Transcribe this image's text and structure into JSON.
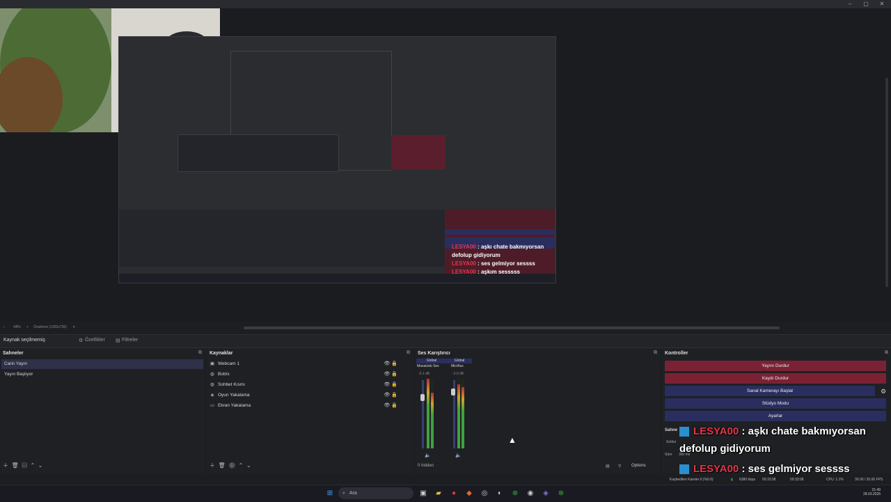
{
  "window": {
    "minimize": "–",
    "maximize": "▢",
    "close": "✕"
  },
  "zoom": {
    "level": "-48%",
    "mode": "Önizleme (1352x756)"
  },
  "source_bar": {
    "status": "Kaynak seçilmemiş",
    "properties": "Özellikler",
    "filters": "Filtreler"
  },
  "scenes": {
    "title": "Sahneler",
    "items": [
      "Canlı Yayın",
      "Yayın Başlıyor"
    ]
  },
  "sources": {
    "title": "Kaynaklar",
    "items": [
      "Webcam 1",
      "Botrix",
      "Sohbet Kısmı",
      "Oyun Yakalama",
      "Ekran Yakalama"
    ]
  },
  "mixer": {
    "title": "Ses Karıştırıcı",
    "channels": [
      {
        "badge": "Global",
        "name": "Masaüstü Ses",
        "db": "-6.1 dB"
      },
      {
        "badge": "Global",
        "name": "Mic/Aux",
        "db": "-3.9 dB"
      }
    ],
    "hidden": "0 hidden",
    "options": "Options"
  },
  "controls": {
    "title": "Kontroller",
    "buttons": [
      "Yayını Durdur",
      "Kaydı Durdur",
      "Sanal Kamerayı Başlat",
      "Stüdyo Modu",
      "Ayarlar"
    ]
  },
  "transitions": {
    "scene": "Sahne",
    "type": "Soldur",
    "duration_label": "Süre",
    "duration": "300 ms"
  },
  "chat": [
    {
      "nick": "LESYA00",
      "text": " : aşkı chate bakmıyorsan",
      "cont": "defolup gidiyorum"
    },
    {
      "nick": "LESYA00",
      "text": " : ses gelmiyor sessss"
    },
    {
      "nick": "LESYA00",
      "text": " : aşkım sesssss"
    }
  ],
  "status": {
    "dropped": "Kaybedilen Kareler 0 (%0.0)",
    "bitrate": "6380 kbps",
    "live_time": "00:33:08",
    "rec_time": "00:33:08",
    "cpu": "CPU: 1.1%",
    "fps": "30.00 / 30.00 FPS"
  },
  "taskbar": {
    "search": "Ara",
    "time": "21:49",
    "date": "28.03.2026"
  }
}
